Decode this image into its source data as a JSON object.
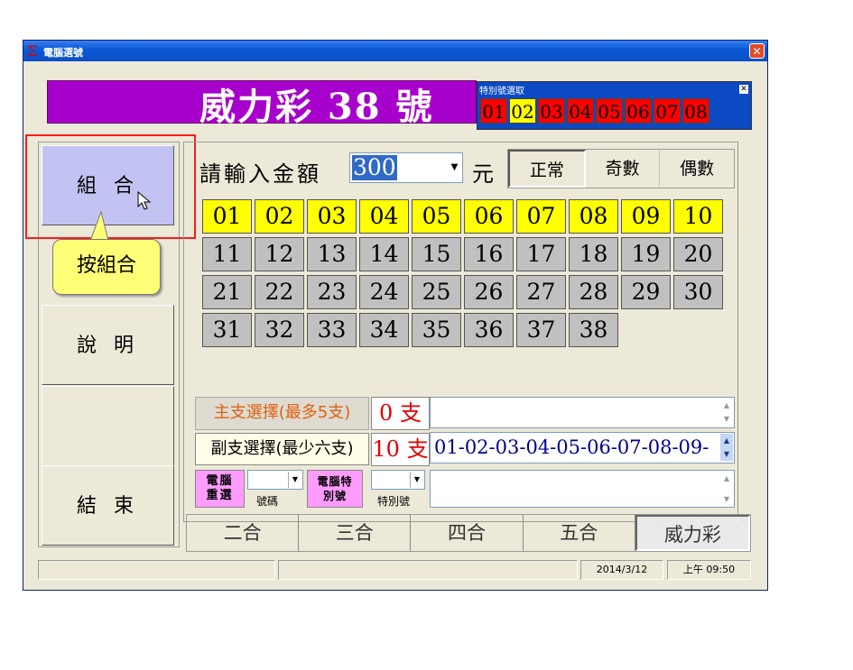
{
  "window": {
    "title": "電腦選號",
    "icon": "sigma-icon",
    "close": "✕"
  },
  "banner": {
    "title": "威力彩 38 號"
  },
  "special_picker": {
    "title": "特別號選取",
    "close": "✕",
    "numbers": [
      "01",
      "02",
      "03",
      "04",
      "05",
      "06",
      "07",
      "08"
    ],
    "selected": "02"
  },
  "left_buttons": {
    "combine": "組 合",
    "explain": "說 明",
    "blank": "",
    "exit": "結 束"
  },
  "tooltip": {
    "text": "按組合"
  },
  "amount": {
    "label": "請輸入金額",
    "value": "300",
    "unit": "元"
  },
  "modes": [
    "正常",
    "奇數",
    "偶數"
  ],
  "number_grid": {
    "numbers": [
      "01",
      "02",
      "03",
      "04",
      "05",
      "06",
      "07",
      "08",
      "09",
      "10",
      "11",
      "12",
      "13",
      "14",
      "15",
      "16",
      "17",
      "18",
      "19",
      "20",
      "21",
      "22",
      "23",
      "24",
      "25",
      "26",
      "27",
      "28",
      "29",
      "30",
      "31",
      "32",
      "33",
      "34",
      "35",
      "36",
      "37",
      "38"
    ],
    "highlighted": [
      "01",
      "02",
      "03",
      "04",
      "05",
      "06",
      "07",
      "08",
      "09",
      "10"
    ]
  },
  "main_select": {
    "label": "主支選擇(最多5支)",
    "count": "0 支",
    "value": ""
  },
  "sub_select": {
    "label": "副支選擇(最少六支)",
    "count": "10 支",
    "value": "01-02-03-04-05-06-07-08-09-"
  },
  "computer_reselect": {
    "label_line1": "電腦",
    "label_line2": "重選",
    "combo_label": "號碼"
  },
  "computer_special": {
    "label_line1": "電腦特",
    "label_line2": "別號",
    "combo_label": "特別號"
  },
  "tabs": [
    "二合",
    "三合",
    "四合",
    "五合",
    "威力彩"
  ],
  "status": {
    "date": "2014/3/12",
    "time": "上午 09:50"
  },
  "colors": {
    "banner": "#a800cc",
    "selected_cell": "#ffff00",
    "special_cell": "#ff0000",
    "button_pink": "#ff9cff"
  }
}
